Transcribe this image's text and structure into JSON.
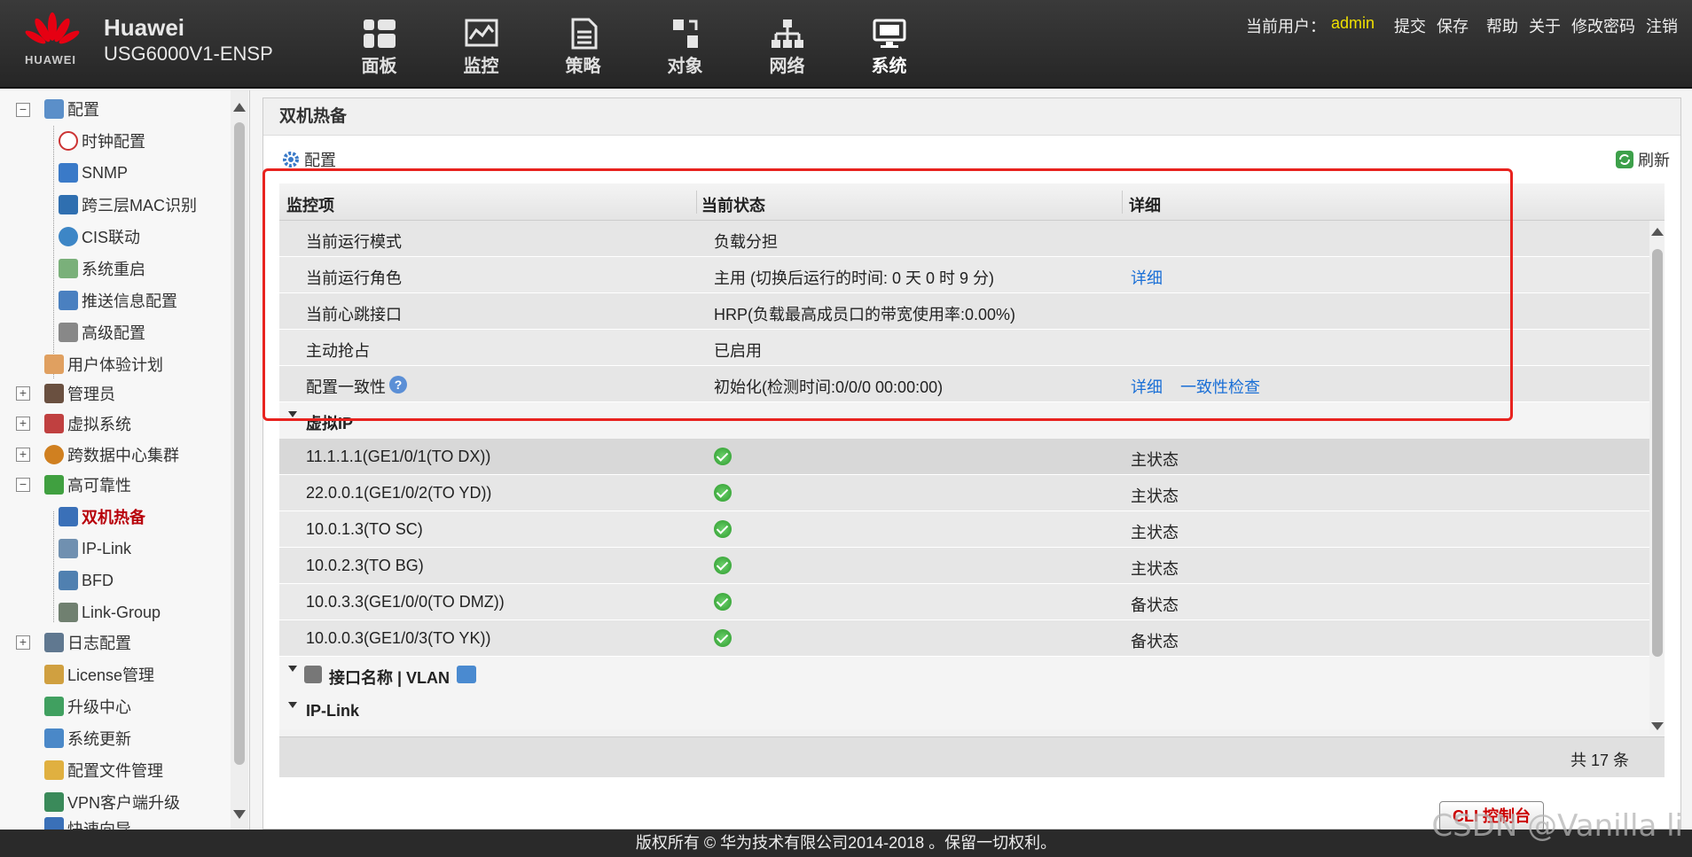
{
  "header": {
    "logo_text": "HUAWEI",
    "brand": "Huawei",
    "model": "USG6000V1-ENSP",
    "nav": [
      {
        "label": "面板",
        "icon": "dashboard-icon"
      },
      {
        "label": "监控",
        "icon": "monitor-icon"
      },
      {
        "label": "策略",
        "icon": "policy-icon"
      },
      {
        "label": "对象",
        "icon": "object-icon"
      },
      {
        "label": "网络",
        "icon": "network-icon"
      },
      {
        "label": "系统",
        "icon": "system-icon",
        "active": true
      }
    ],
    "user_label": "当前用户：",
    "user": "admin",
    "links": [
      "提交",
      "保存",
      "帮助",
      "关于",
      "修改密码",
      "注销"
    ]
  },
  "sidebar": {
    "items": [
      {
        "label": "配置",
        "icon": "config-icon"
      },
      {
        "label": "时钟配置",
        "icon": "clock-icon"
      },
      {
        "label": "SNMP",
        "icon": "snmp-icon"
      },
      {
        "label": "跨三层MAC识别",
        "icon": "mac-icon"
      },
      {
        "label": "CIS联动",
        "icon": "cis-icon"
      },
      {
        "label": "系统重启",
        "icon": "restart-icon"
      },
      {
        "label": "推送信息配置",
        "icon": "push-icon"
      },
      {
        "label": "高级配置",
        "icon": "advanced-icon"
      },
      {
        "label": "用户体验计划",
        "icon": "ux-icon"
      },
      {
        "label": "管理员",
        "icon": "admin-icon"
      },
      {
        "label": "虚拟系统",
        "icon": "vsys-icon"
      },
      {
        "label": "跨数据中心集群",
        "icon": "cluster-icon"
      },
      {
        "label": "高可靠性",
        "icon": "ha-icon"
      },
      {
        "label": "双机热备",
        "icon": "hrp-icon"
      },
      {
        "label": "IP-Link",
        "icon": "iplink-icon"
      },
      {
        "label": "BFD",
        "icon": "bfd-icon"
      },
      {
        "label": "Link-Group",
        "icon": "linkgroup-icon"
      },
      {
        "label": "日志配置",
        "icon": "log-icon"
      },
      {
        "label": "License管理",
        "icon": "license-icon"
      },
      {
        "label": "升级中心",
        "icon": "upgrade-icon"
      },
      {
        "label": "系统更新",
        "icon": "update-icon"
      },
      {
        "label": "配置文件管理",
        "icon": "file-icon"
      },
      {
        "label": "VPN客户端升级",
        "icon": "vpn-icon"
      },
      {
        "label": "快速向导",
        "icon": "wizard-icon"
      }
    ]
  },
  "content": {
    "title": "双机热备",
    "config_label": "配置",
    "refresh_label": "刷新",
    "columns": [
      "监控项",
      "当前状态",
      "详细"
    ],
    "rows": [
      {
        "item": "当前运行模式",
        "status": "负载分担",
        "detail": ""
      },
      {
        "item": "当前运行角色",
        "status": "主用 (切换后运行的时间: 0 天 0 时 9 分)",
        "detail": "详细"
      },
      {
        "item": "当前心跳接口",
        "status": "HRP(负载最高成员口的带宽使用率:0.00%)",
        "detail": ""
      },
      {
        "item": "主动抢占",
        "status": "已启用",
        "detail": ""
      },
      {
        "item": "配置一致性",
        "status": "初始化(检测时间:0/0/0 00:00:00)",
        "detail": "详细",
        "detail2": "一致性检查"
      }
    ],
    "group_vip": "虚拟IP",
    "vip_rows": [
      {
        "item": "11.1.1.1(GE1/0/1(TO DX))",
        "state": "主状态"
      },
      {
        "item": "22.0.0.1(GE1/0/2(TO YD))",
        "state": "主状态"
      },
      {
        "item": "10.0.1.3(TO SC)",
        "state": "主状态"
      },
      {
        "item": "10.0.2.3(TO BG)",
        "state": "主状态"
      },
      {
        "item": "10.0.3.3(GE1/0/0(TO DMZ))",
        "state": "备状态"
      },
      {
        "item": "10.0.0.3(GE1/0/3(TO YK))",
        "state": "备状态"
      }
    ],
    "group_iface": "接口名称 | VLAN",
    "group_iplink": "IP-Link",
    "total": "共 17 条",
    "cli_label": "CLI 控制台"
  },
  "footer": "版权所有 © 华为技术有限公司2014-2018 。保留一切权利。",
  "watermark": "CSDN @Vanilla li"
}
